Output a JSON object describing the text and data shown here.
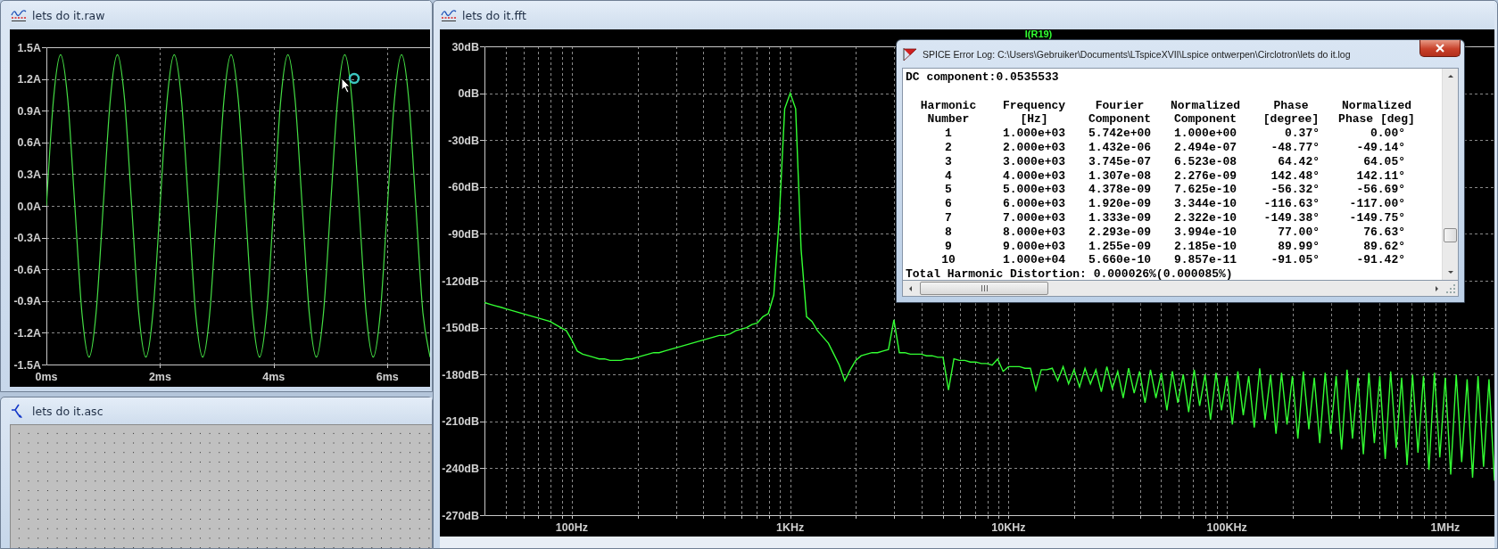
{
  "raw_window": {
    "title": "lets do it.raw",
    "chart_data": {
      "type": "line",
      "grid": true,
      "x": [
        0,
        0.125,
        0.25,
        0.375,
        0.5,
        0.625,
        0.75,
        0.875,
        1,
        1.125,
        1.25,
        1.375,
        1.5,
        1.625,
        1.75,
        1.875,
        2,
        2.125,
        2.25,
        2.375,
        2.5,
        2.625,
        2.75,
        2.875,
        3,
        3.125,
        3.25,
        3.375,
        3.5,
        3.625,
        3.75,
        3.875,
        4,
        4.125,
        4.25,
        4.375,
        4.5,
        4.625,
        4.75,
        4.875,
        5,
        5.125,
        5.25,
        5.375,
        5.5,
        5.625,
        5.75,
        5.875,
        6,
        6.125,
        6.25,
        6.375,
        6.5,
        6.625,
        6.75
      ],
      "series": [
        {
          "color": "#44dd44",
          "values": [
            0,
            1.01,
            1.43,
            1.01,
            0,
            -1.01,
            -1.43,
            -1.01,
            0,
            1.01,
            1.43,
            1.01,
            0,
            -1.01,
            -1.43,
            -1.01,
            0,
            1.01,
            1.43,
            1.01,
            0,
            -1.01,
            -1.43,
            -1.01,
            0,
            1.01,
            1.43,
            1.01,
            0,
            -1.01,
            -1.43,
            -1.01,
            0,
            1.01,
            1.43,
            1.01,
            0,
            -1.01,
            -1.43,
            -1.01,
            0,
            1.01,
            1.43,
            1.01,
            0,
            -1.01,
            -1.43,
            -1.01,
            0,
            1.01,
            1.43,
            1.01,
            0,
            -1.01,
            -1.43
          ]
        }
      ],
      "xlim": [
        0,
        6.75
      ],
      "ylim": [
        -1.5,
        1.5
      ],
      "xticks": [
        {
          "value": 0,
          "label": "0ms"
        },
        {
          "value": 2,
          "label": "2ms"
        },
        {
          "value": 4,
          "label": "4ms"
        },
        {
          "value": 6,
          "label": "6ms"
        }
      ],
      "yticks": [
        {
          "value": 1.5,
          "label": "1.5A"
        },
        {
          "value": 1.2,
          "label": "1.2A"
        },
        {
          "value": 0.9,
          "label": "0.9A"
        },
        {
          "value": 0.6,
          "label": "0.6A"
        },
        {
          "value": 0.3,
          "label": "0.3A"
        },
        {
          "value": 0,
          "label": "0.0A"
        },
        {
          "value": -0.3,
          "label": "-0.3A"
        },
        {
          "value": -0.6,
          "label": "-0.6A"
        },
        {
          "value": -0.9,
          "label": "-0.9A"
        },
        {
          "value": -1.2,
          "label": "-1.2A"
        },
        {
          "value": -1.5,
          "label": "-1.5A"
        }
      ]
    }
  },
  "schematic_window": {
    "title": "lets do it.asc"
  },
  "fft_window": {
    "title": "lets do it.fft",
    "chart_data": {
      "type": "line",
      "grid": true,
      "categories": [
        null,
        null,
        null,
        null,
        null,
        null,
        null,
        null,
        null,
        null,
        null,
        null,
        null,
        null,
        null,
        null,
        "100Hz",
        null,
        null,
        null,
        null,
        null,
        null,
        null,
        null,
        null,
        null,
        null,
        null,
        null,
        null,
        null,
        null,
        null,
        null,
        null,
        null,
        null,
        null,
        null,
        null,
        null,
        null,
        null,
        null,
        null,
        null,
        null,
        null,
        null,
        null,
        null,
        null,
        null,
        null,
        null,
        "1KHz",
        null,
        null,
        null,
        null,
        null,
        null,
        null,
        null,
        null,
        null,
        null,
        null,
        null,
        null,
        null,
        null,
        null,
        null,
        null,
        null,
        null,
        null,
        null,
        null,
        null,
        null,
        null,
        null,
        null,
        null,
        null,
        null,
        null,
        null,
        null,
        null,
        null,
        null,
        null,
        "10KHz",
        null,
        null,
        null,
        null,
        null,
        null,
        null,
        null,
        null,
        null,
        null,
        null,
        null,
        null,
        null,
        null,
        null,
        null,
        null,
        null,
        null,
        null,
        null,
        null,
        null,
        null,
        null,
        null,
        null,
        null,
        null,
        null,
        null,
        null,
        null,
        null,
        null,
        null,
        null,
        "100KHz",
        null,
        null,
        null,
        null,
        null,
        null,
        null,
        null,
        null,
        null,
        null,
        null,
        null,
        null,
        null,
        null,
        null,
        null,
        null,
        null,
        null,
        null,
        null,
        null,
        null,
        null,
        null,
        null,
        null,
        null,
        null,
        null,
        null,
        null,
        null,
        null,
        null,
        null,
        null,
        "1MHz",
        null,
        null,
        null,
        null,
        null,
        null,
        null,
        null,
        null
      ],
      "series": [
        {
          "name": "I(R19)",
          "color": "#33ff33",
          "values": [
            -134,
            -135,
            -136,
            -137,
            -138,
            -139,
            -140,
            -141,
            -142,
            -143,
            -144,
            -145,
            -146,
            -148,
            -150,
            -152,
            -158,
            -165,
            -167,
            -168,
            -169,
            -170,
            -170,
            -171,
            -171,
            -171,
            -170,
            -170,
            -169,
            -168,
            -167,
            -166,
            -166,
            -165,
            -164,
            -163,
            -162,
            -161,
            -160,
            -159,
            -158,
            -157,
            -156,
            -155,
            -155,
            -154,
            -152,
            -151,
            -150,
            -148,
            -147,
            -143,
            -141,
            -129,
            -80,
            -10,
            0,
            -10,
            -100,
            -143,
            -146,
            -152,
            -156,
            -160,
            -167,
            -174,
            -184,
            -177,
            -171,
            -168,
            -167,
            -166,
            -166,
            -165,
            -164,
            -145,
            -166,
            -166,
            -167,
            -167,
            -167,
            -168,
            -168,
            -169,
            -169,
            -190,
            -170,
            -171,
            -171,
            -172,
            -172,
            -173,
            -173,
            -174,
            -170,
            -178,
            -175,
            -175,
            -175,
            -176,
            -176,
            -190,
            -177,
            -177,
            -176,
            -184,
            -175,
            -186,
            -177,
            -188,
            -176,
            -186,
            -177,
            -191,
            -175,
            -189,
            -178,
            -195,
            -176,
            -192,
            -178,
            -198,
            -177,
            -195,
            -179,
            -203,
            -178,
            -198,
            -180,
            -204,
            -177,
            -200,
            -180,
            -209,
            -179,
            -203,
            -181,
            -212,
            -178,
            -206,
            -181,
            -214,
            -176,
            -209,
            -180,
            -218,
            -179,
            -212,
            -181,
            -221,
            -178,
            -215,
            -182,
            -224,
            -179,
            -218,
            -181,
            -228,
            -177,
            -221,
            -182,
            -231,
            -179,
            -224,
            -181,
            -234,
            -178,
            -227,
            -182,
            -238,
            -180,
            -230,
            -181,
            -241,
            -179,
            -233,
            -182,
            -244,
            -180,
            -236,
            -183,
            -246,
            -181,
            -239,
            -183,
            -248
          ]
        }
      ],
      "ylim": [
        -270,
        30
      ],
      "yticks": [
        {
          "value": 30,
          "label": "30dB"
        },
        {
          "value": 0,
          "label": "0dB"
        },
        {
          "value": -30,
          "label": "-30dB"
        },
        {
          "value": -60,
          "label": "-60dB"
        },
        {
          "value": -90,
          "label": "-90dB"
        },
        {
          "value": -120,
          "label": "-120dB"
        },
        {
          "value": -150,
          "label": "-150dB"
        },
        {
          "value": -180,
          "label": "-180dB"
        },
        {
          "value": -210,
          "label": "-210dB"
        },
        {
          "value": -240,
          "label": "-240dB"
        },
        {
          "value": -270,
          "label": "-270dB"
        }
      ]
    }
  },
  "error_log": {
    "title": "SPICE Error Log: C:\\Users\\Gebruiker\\Documents\\LTspiceXVII\\Lspice ontwerpen\\Circlotron\\lets do it.log",
    "dc_line": "DC component:0.0535533",
    "header_lines": [
      [
        "Harmonic",
        "Frequency",
        "Fourier",
        "Normalized",
        "Phase",
        "Normalized"
      ],
      [
        "Number",
        "[Hz]",
        "Component",
        "Component",
        "[degree]",
        "Phase [deg]"
      ]
    ],
    "rows": [
      [
        "1",
        "1.000e+03",
        "5.742e+00",
        "1.000e+00",
        "0.37°",
        "0.00°"
      ],
      [
        "2",
        "2.000e+03",
        "1.432e-06",
        "2.494e-07",
        "-48.77°",
        "-49.14°"
      ],
      [
        "3",
        "3.000e+03",
        "3.745e-07",
        "6.523e-08",
        "64.42°",
        "64.05°"
      ],
      [
        "4",
        "4.000e+03",
        "1.307e-08",
        "2.276e-09",
        "142.48°",
        "142.11°"
      ],
      [
        "5",
        "5.000e+03",
        "4.378e-09",
        "7.625e-10",
        "-56.32°",
        "-56.69°"
      ],
      [
        "6",
        "6.000e+03",
        "1.920e-09",
        "3.344e-10",
        "-116.63°",
        "-117.00°"
      ],
      [
        "7",
        "7.000e+03",
        "1.333e-09",
        "2.322e-10",
        "-149.38°",
        "-149.75°"
      ],
      [
        "8",
        "8.000e+03",
        "2.293e-09",
        "3.994e-10",
        "77.00°",
        "76.63°"
      ],
      [
        "9",
        "9.000e+03",
        "1.255e-09",
        "2.185e-10",
        "89.99°",
        "89.62°"
      ],
      [
        "10",
        "1.000e+04",
        "5.660e-10",
        "9.857e-11",
        "-91.05°",
        "-91.42°"
      ]
    ],
    "summary": "Total Harmonic Distortion: 0.000026%(0.000085%)"
  }
}
